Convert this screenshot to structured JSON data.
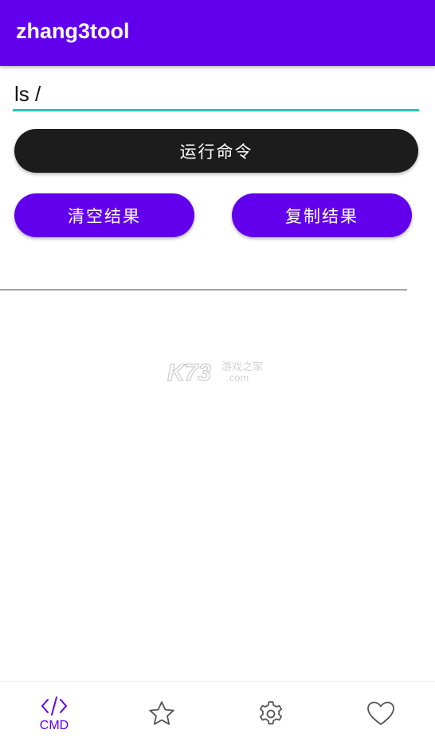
{
  "app": {
    "title": "zhang3tool"
  },
  "command": {
    "value": "ls /"
  },
  "buttons": {
    "run": "运行命令",
    "clear": "清空结果",
    "copy": "复制结果"
  },
  "watermark": {
    "brand": "K73",
    "cn": "游戏之家",
    "domain": ".com"
  },
  "bottom_nav": {
    "items": [
      {
        "label": "CMD",
        "icon": "code-icon",
        "active": true
      },
      {
        "label": "",
        "icon": "star-icon",
        "active": false
      },
      {
        "label": "",
        "icon": "gear-icon",
        "active": false
      },
      {
        "label": "",
        "icon": "heart-icon",
        "active": false
      }
    ]
  },
  "colors": {
    "primary": "#6200ee",
    "run_button": "#1c1c1c",
    "input_underline": "#26c6b9",
    "inactive_icon": "#555555"
  }
}
